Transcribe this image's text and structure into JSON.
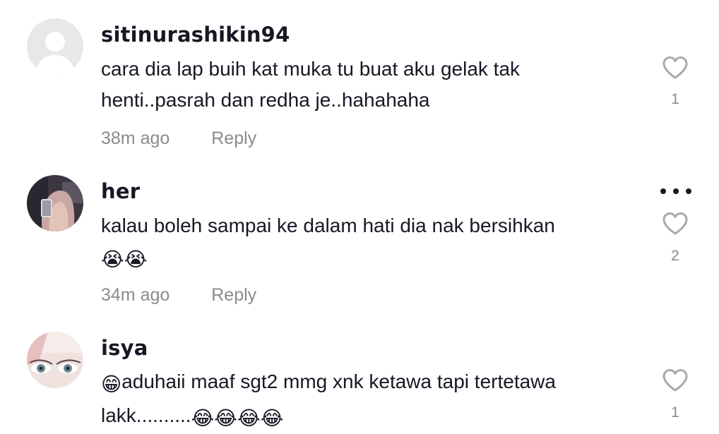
{
  "comments": [
    {
      "username": "sitinurashikin94",
      "text": "cara dia lap buih kat muka tu buat aku gelak tak henti..pasrah dan redha je..hahahaha",
      "time": "38m ago",
      "reply": "Reply",
      "likes": "1",
      "avatar": "default-avatar-icon"
    },
    {
      "username": "her",
      "text": "kalau boleh sampai ke dalam hati dia nak bersihkan",
      "emojis": "😭😭",
      "time": "34m ago",
      "reply": "Reply",
      "likes": "2",
      "avatar": "user-photo-hijab"
    },
    {
      "username": "isya",
      "emoji_prefix": "😁",
      "text": "aduhaii maaf sgt2 mmg xnk ketawa tapi tertetawa lakk..........",
      "emojis": "😂😂😂😂",
      "time": "",
      "reply": "",
      "likes": "1",
      "avatar": "user-photo-face"
    }
  ],
  "colors": {
    "text": "#161823",
    "secondary": "#8a8b91",
    "icon": "#a8a9ad"
  }
}
